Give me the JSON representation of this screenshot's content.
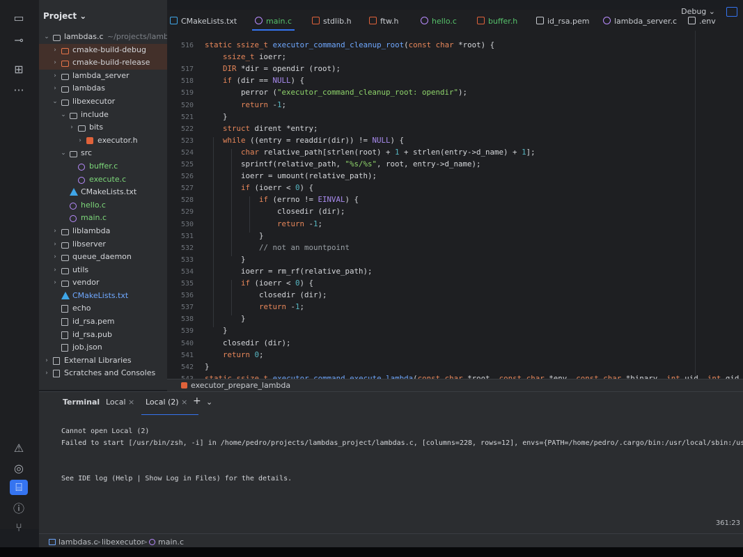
{
  "top": {
    "config": "Debug ⌄"
  },
  "project_panel": {
    "title": "Project ⌄",
    "tree": [
      {
        "label": "lambdas.c",
        "suffix": "~/projects/lamb",
        "depth": 0,
        "open": true,
        "icon": "folder"
      },
      {
        "label": "cmake-build-debug",
        "depth": 1,
        "icon": "folder-orange",
        "sel": true
      },
      {
        "label": "cmake-build-release",
        "depth": 1,
        "icon": "folder-orange",
        "sel": true
      },
      {
        "label": "lambda_server",
        "depth": 1,
        "icon": "folder"
      },
      {
        "label": "lambdas",
        "depth": 1,
        "icon": "folder"
      },
      {
        "label": "libexecutor",
        "depth": 1,
        "open": true,
        "icon": "folder"
      },
      {
        "label": "include",
        "depth": 2,
        "open": true,
        "icon": "folder"
      },
      {
        "label": "bits",
        "depth": 3,
        "icon": "folder"
      },
      {
        "label": "executor.h",
        "depth": 4,
        "icon": "h-file"
      },
      {
        "label": "src",
        "depth": 2,
        "open": true,
        "icon": "folder"
      },
      {
        "label": "buffer.c",
        "depth": 3,
        "icon": "c-file",
        "color": "green",
        "leaf": true
      },
      {
        "label": "execute.c",
        "depth": 3,
        "icon": "c-file",
        "color": "green",
        "leaf": true
      },
      {
        "label": "CMakeLists.txt",
        "depth": 2,
        "icon": "cmake-file",
        "leaf": true
      },
      {
        "label": "hello.c",
        "depth": 2,
        "icon": "c-file",
        "color": "green",
        "leaf": true
      },
      {
        "label": "main.c",
        "depth": 2,
        "icon": "c-file",
        "color": "green",
        "leaf": true
      },
      {
        "label": "liblambda",
        "depth": 1,
        "icon": "folder"
      },
      {
        "label": "libserver",
        "depth": 1,
        "icon": "folder"
      },
      {
        "label": "queue_daemon",
        "depth": 1,
        "icon": "folder"
      },
      {
        "label": "utils",
        "depth": 1,
        "icon": "folder"
      },
      {
        "label": "vendor",
        "depth": 1,
        "icon": "folder"
      },
      {
        "label": "CMakeLists.txt",
        "depth": 1,
        "icon": "cmake-file",
        "color": "blue",
        "leaf": true
      },
      {
        "label": "echo",
        "depth": 1,
        "icon": "generic-file",
        "leaf": true
      },
      {
        "label": "id_rsa.pem",
        "depth": 1,
        "icon": "generic-file",
        "leaf": true
      },
      {
        "label": "id_rsa.pub",
        "depth": 1,
        "icon": "generic-file",
        "leaf": true
      },
      {
        "label": "job.json",
        "depth": 1,
        "icon": "json-file",
        "leaf": true
      },
      {
        "label": "External Libraries",
        "depth": 0,
        "icon": "library"
      },
      {
        "label": "Scratches and Consoles",
        "depth": 0,
        "icon": "scratches"
      }
    ]
  },
  "tabs": [
    {
      "label": "CMakeLists.txt",
      "icon": "cmake-file"
    },
    {
      "label": "main.c",
      "icon": "c-file",
      "active": true
    },
    {
      "label": "stdlib.h",
      "icon": "h-file"
    },
    {
      "label": "ftw.h",
      "icon": "h-file"
    },
    {
      "label": "hello.c",
      "icon": "c-file",
      "color": "green"
    },
    {
      "label": "buffer.h",
      "icon": "h-file",
      "color": "green"
    },
    {
      "label": "id_rsa.pem",
      "icon": "text-file"
    },
    {
      "label": "lambda_server.c",
      "icon": "c-file"
    },
    {
      "label": ".env",
      "icon": "text-file"
    }
  ],
  "editor": {
    "lines": [
      {
        "n": "516",
        "indent": 0,
        "code": "static ssize_t executor_command_cleanup_root(const char *root) {"
      },
      {
        "n": "",
        "indent": 1,
        "code": "ssize_t ioerr;"
      },
      {
        "n": "517",
        "indent": 1,
        "code": "DIR *dir = opendir (root);"
      },
      {
        "n": "518",
        "indent": 1,
        "code": "if (dir == NULL) {"
      },
      {
        "n": "519",
        "indent": 2,
        "code": "perror (\"executor_command_cleanup_root: opendir\");"
      },
      {
        "n": "520",
        "indent": 2,
        "code": "return -1;"
      },
      {
        "n": "521",
        "indent": 1,
        "code": "}"
      },
      {
        "n": "522",
        "indent": 1,
        "code": "struct dirent *entry;"
      },
      {
        "n": "523",
        "indent": 1,
        "code": "while ((entry = readdir(dir)) != NULL) {"
      },
      {
        "n": "524",
        "indent": 2,
        "code": "char relative_path[strlen(root) + 1 + strlen(entry->d_name) + 1];"
      },
      {
        "n": "525",
        "indent": 2,
        "code": "sprintf(relative_path, \"%s/%s\", root, entry->d_name);"
      },
      {
        "n": "526",
        "indent": 2,
        "code": "ioerr = umount(relative_path);"
      },
      {
        "n": "527",
        "indent": 2,
        "code": "if (ioerr < 0) {"
      },
      {
        "n": "528",
        "indent": 3,
        "code": "if (errno != EINVAL) {"
      },
      {
        "n": "529",
        "indent": 4,
        "code": "closedir (dir);"
      },
      {
        "n": "530",
        "indent": 4,
        "code": "return -1;"
      },
      {
        "n": "531",
        "indent": 3,
        "code": "}"
      },
      {
        "n": "532",
        "indent": 3,
        "code": "// not an mountpoint"
      },
      {
        "n": "533",
        "indent": 2,
        "code": "}"
      },
      {
        "n": "534",
        "indent": 2,
        "code": "ioerr = rm_rf(relative_path);"
      },
      {
        "n": "535",
        "indent": 2,
        "code": "if (ioerr < 0) {"
      },
      {
        "n": "536",
        "indent": 3,
        "code": "closedir (dir);"
      },
      {
        "n": "537",
        "indent": 3,
        "code": "return -1;"
      },
      {
        "n": "538",
        "indent": 2,
        "code": "}"
      },
      {
        "n": "539",
        "indent": 1,
        "code": "}"
      },
      {
        "n": "540",
        "indent": 1,
        "code": "closedir (dir);"
      },
      {
        "n": "541",
        "indent": 1,
        "code": "return 0;"
      },
      {
        "n": "542",
        "indent": 0,
        "code": "}"
      },
      {
        "n": "543",
        "indent": 0,
        "code": "static ssize_t executor_command_execute_lambda(const char *root, const char *env, const char *binary, int uid, int gid, int argc, cor"
      }
    ],
    "sticky_scope": "executor_prepare_lambda"
  },
  "terminal": {
    "title": "Terminal",
    "tabs": [
      {
        "label": "Local",
        "active": false
      },
      {
        "label": "Local (2)",
        "active": true
      }
    ],
    "add": "+",
    "more": "⌄",
    "close": "×",
    "lines": [
      "Cannot open Local (2)",
      "Failed to start [/usr/bin/zsh, -i] in /home/pedro/projects/lambdas_project/lambdas.c, [columns=228, rows=12], envs={PATH=/home/pedro/.cargo/bin:/usr/local/sbin:/usr/local/",
      "",
      "",
      "See IDE log (Help | Show Log in Files) for the details."
    ],
    "cursor_pos": "361:23"
  },
  "statusbar": {
    "crumbs": [
      "lambdas.c",
      "libexecutor",
      "main.c"
    ],
    "sep": ">"
  },
  "colors": {
    "accent": "#3574f0",
    "keyword": "#e8875a",
    "function": "#6fa8ff",
    "string": "#8fd46b",
    "active_tab": "#56c26b"
  }
}
